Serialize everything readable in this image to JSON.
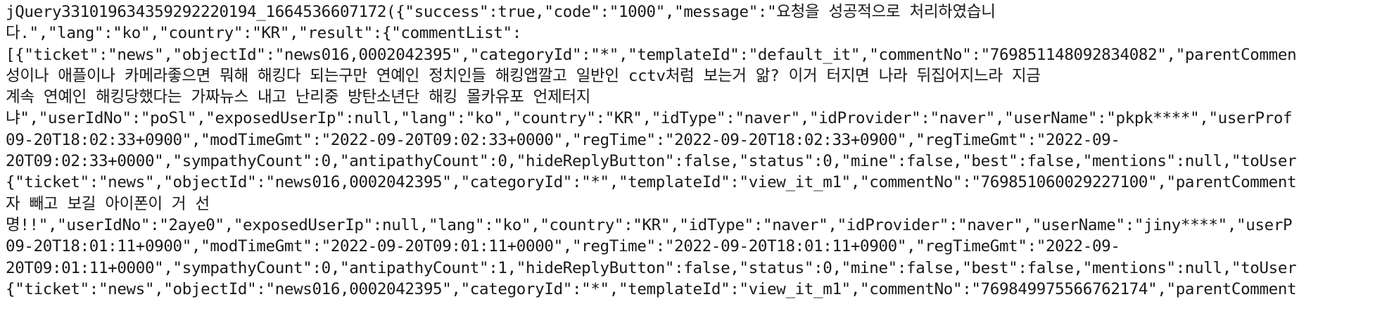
{
  "document": {
    "lines": [
      "jQuery331019634359292220194_1664536607172({\"success\":true,\"code\":\"1000\",\"message\":\"요청을 성공적으로 처리하였습니",
      "다.\",\"lang\":\"ko\",\"country\":\"KR\",\"result\":{\"commentList\":",
      "[{\"ticket\":\"news\",\"objectId\":\"news016,0002042395\",\"categoryId\":\"*\",\"templateId\":\"default_it\",\"commentNo\":\"769851148092834082\",\"parentCommen",
      "성이나 애플이나 카메라좋으면 뭐해 해킹다 되는구만 연예인 정치인들 해킹앱깔고 일반인 cctv처럼 보는거 앎? 이거 터지면 나라 뒤집어지느라 지금",
      "계속 연예인 해킹당했다는 가짜뉴스 내고 난리중 방탄소년단 해킹 몰카유포 언제터지",
      "냐\",\"userIdNo\":\"poSl\",\"exposedUserIp\":null,\"lang\":\"ko\",\"country\":\"KR\",\"idType\":\"naver\",\"idProvider\":\"naver\",\"userName\":\"pkpk****\",\"userProf",
      "09-20T18:02:33+0900\",\"modTimeGmt\":\"2022-09-20T09:02:33+0000\",\"regTime\":\"2022-09-20T18:02:33+0900\",\"regTimeGmt\":\"2022-09-",
      "20T09:02:33+0000\",\"sympathyCount\":0,\"antipathyCount\":0,\"hideReplyButton\":false,\"status\":0,\"mine\":false,\"best\":false,\"mentions\":null,\"toUser",
      "{\"ticket\":\"news\",\"objectId\":\"news016,0002042395\",\"categoryId\":\"*\",\"templateId\":\"view_it_m1\",\"commentNo\":\"769851060029227100\",\"parentComment",
      "자 빼고 보길 아이폰이 거 선",
      "명!!\",\"userIdNo\":\"2aye0\",\"exposedUserIp\":null,\"lang\":\"ko\",\"country\":\"KR\",\"idType\":\"naver\",\"idProvider\":\"naver\",\"userName\":\"jiny****\",\"userP",
      "09-20T18:01:11+0900\",\"modTimeGmt\":\"2022-09-20T09:01:11+0000\",\"regTime\":\"2022-09-20T18:01:11+0900\",\"regTimeGmt\":\"2022-09-",
      "20T09:01:11+0000\",\"sympathyCount\":0,\"antipathyCount\":1,\"hideReplyButton\":false,\"status\":0,\"mine\":false,\"best\":false,\"mentions\":null,\"toUser",
      "{\"ticket\":\"news\",\"objectId\":\"news016,0002042395\",\"categoryId\":\"*\",\"templateId\":\"view_it_m1\",\"commentNo\":\"769849975566762174\",\"parentComment"
    ]
  }
}
